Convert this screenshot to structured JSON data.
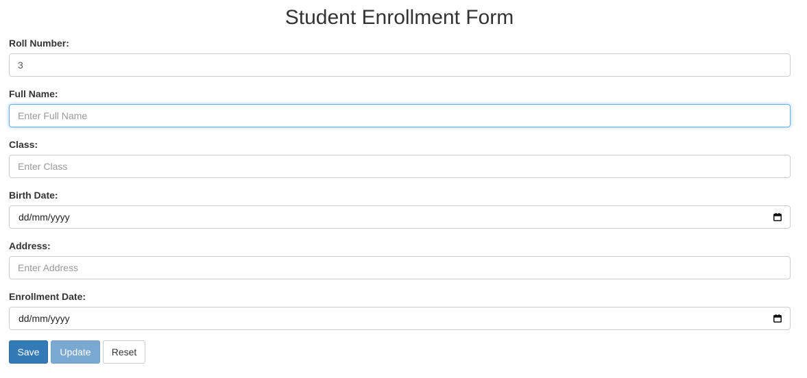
{
  "form": {
    "title": "Student Enrollment Form",
    "fields": {
      "roll_number": {
        "label": "Roll Number:",
        "value": "3",
        "placeholder": ""
      },
      "full_name": {
        "label": "Full Name:",
        "value": "",
        "placeholder": "Enter Full Name"
      },
      "class": {
        "label": "Class:",
        "value": "",
        "placeholder": "Enter Class"
      },
      "birth_date": {
        "label": "Birth Date:",
        "display": "dd/mm/yyyy",
        "icon": "calendar-icon"
      },
      "address": {
        "label": "Address:",
        "value": "",
        "placeholder": "Enter Address"
      },
      "enrollment_date": {
        "label": "Enrollment Date:",
        "display": "dd/mm/yyyy",
        "icon": "calendar-icon"
      }
    },
    "buttons": {
      "save": "Save",
      "update": "Update",
      "reset": "Reset"
    }
  },
  "colors": {
    "primary": "#337ab7",
    "focus_border": "#66afe9",
    "text": "#333333",
    "placeholder": "#999999",
    "border": "#cccccc"
  }
}
